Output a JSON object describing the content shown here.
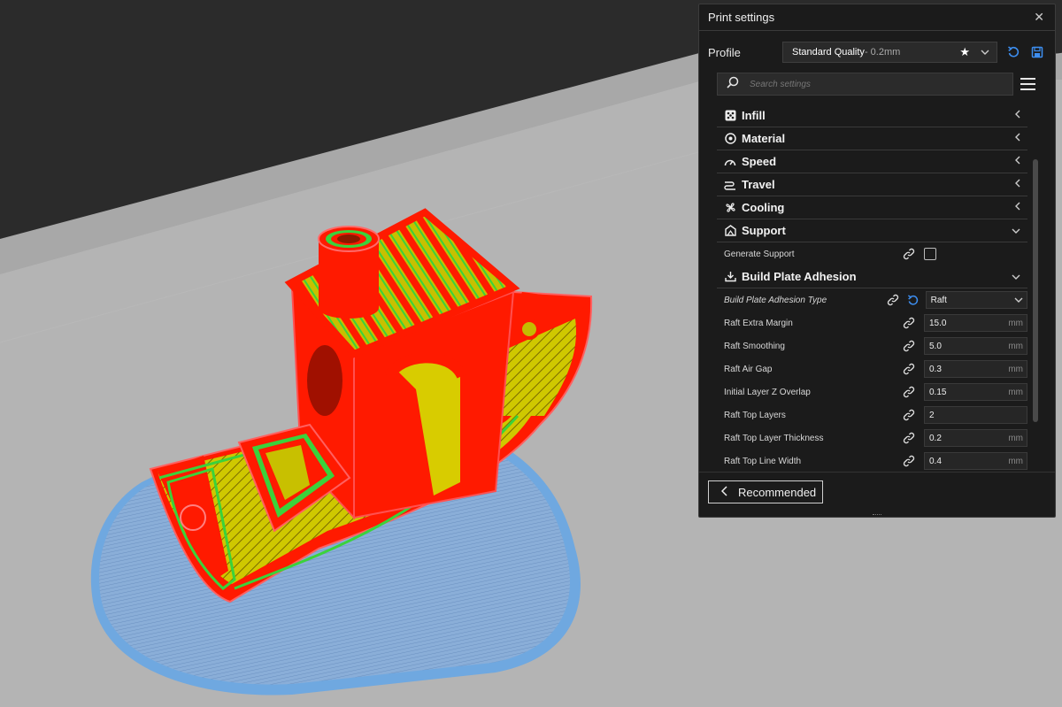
{
  "panel": {
    "title": "Print settings",
    "close_icon": "close-icon",
    "profile": {
      "label": "Profile",
      "value_main": "Standard Quality",
      "value_sub": " - 0.2mm",
      "favorite_icon": "star-icon",
      "reset_icon": "undo-icon",
      "save_icon": "save-icon"
    },
    "search": {
      "placeholder": "Search settings",
      "icon": "search-icon",
      "menu_icon": "menu-icon"
    },
    "categories": [
      {
        "label": "Infill",
        "icon": "infill-icon",
        "expanded": false
      },
      {
        "label": "Material",
        "icon": "material-icon",
        "expanded": false
      },
      {
        "label": "Speed",
        "icon": "speed-icon",
        "expanded": false
      },
      {
        "label": "Travel",
        "icon": "travel-icon",
        "expanded": false
      },
      {
        "label": "Cooling",
        "icon": "cooling-icon",
        "expanded": false
      },
      {
        "label": "Support",
        "icon": "support-icon",
        "expanded": true
      },
      {
        "label": "Build Plate Adhesion",
        "icon": "adhesion-icon",
        "expanded": true
      }
    ],
    "support_settings": [
      {
        "label": "Generate Support",
        "type": "checkbox",
        "checked": false
      }
    ],
    "adhesion_settings": [
      {
        "label": "Build Plate Adhesion Type",
        "type": "dropdown",
        "value": "Raft",
        "modified": true
      },
      {
        "label": "Raft Extra Margin",
        "value": "15.0",
        "unit": "mm"
      },
      {
        "label": "Raft Smoothing",
        "value": "5.0",
        "unit": "mm"
      },
      {
        "label": "Raft Air Gap",
        "value": "0.3",
        "unit": "mm"
      },
      {
        "label": "Initial Layer Z Overlap",
        "value": "0.15",
        "unit": "mm"
      },
      {
        "label": "Raft Top Layers",
        "value": "2",
        "unit": ""
      },
      {
        "label": "Raft Top Layer Thickness",
        "value": "0.2",
        "unit": "mm"
      },
      {
        "label": "Raft Top Line Width",
        "value": "0.4",
        "unit": "mm"
      }
    ],
    "footer": {
      "recommended_label": "Recommended"
    }
  },
  "colors": {
    "accent": "#3d8ef0",
    "model_red": "#ff1a00",
    "infill_yellow": "#d8d000",
    "wall_green": "#3dd63d",
    "raft_blue": "#7fa7d8",
    "bed_gray": "#b2b2b2",
    "background": "#2a2a2a"
  }
}
